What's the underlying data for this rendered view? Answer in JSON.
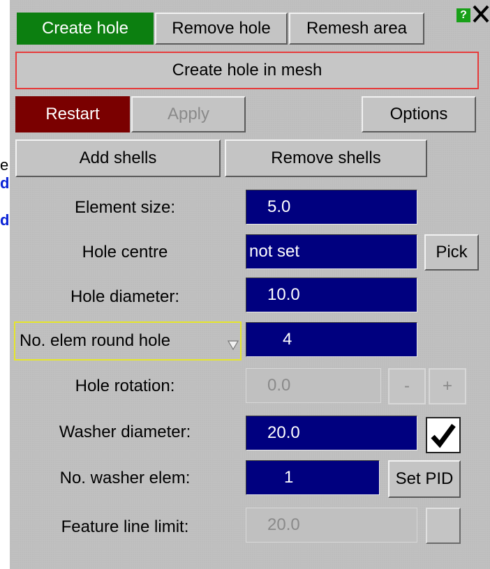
{
  "edge_fragments": [
    "e",
    "d",
    "d"
  ],
  "tabs": [
    {
      "label": "Create hole",
      "active": true
    },
    {
      "label": "Remove hole",
      "active": false
    },
    {
      "label": "Remesh area",
      "active": false
    }
  ],
  "header": {
    "help_glyph": "?",
    "close_glyph": "X"
  },
  "mode_title": "Create hole in mesh",
  "actions": {
    "restart": "Restart",
    "apply": "Apply",
    "options": "Options"
  },
  "shells": {
    "add": "Add shells",
    "remove": "Remove shells"
  },
  "fields": {
    "element_size": {
      "label": "Element size:",
      "value": "5.0"
    },
    "hole_centre": {
      "label": "Hole centre",
      "value": "not set",
      "button": "Pick"
    },
    "hole_diameter": {
      "label": "Hole diameter:",
      "value": "10.0"
    },
    "no_elem_round_hole": {
      "label": "No. elem round hole",
      "value": "4"
    },
    "hole_rotation": {
      "label": "Hole rotation:",
      "value": "0.0",
      "minus": "-",
      "plus": "+"
    },
    "washer_diameter": {
      "label": "Washer diameter:",
      "value": "20.0",
      "checked": true
    },
    "no_washer_elem": {
      "label": "No. washer elem:",
      "value": "1",
      "button": "Set PID"
    },
    "feature_line_limit": {
      "label": "Feature line limit:",
      "value": "20.0"
    }
  },
  "colors": {
    "panel_bg": "#bdbdbd",
    "active_tab": "#0c7f10",
    "restart_bg": "#7a0000",
    "field_bg": "#00007f",
    "title_border": "#e63a3a",
    "dropdown_border": "#e5e52a"
  }
}
